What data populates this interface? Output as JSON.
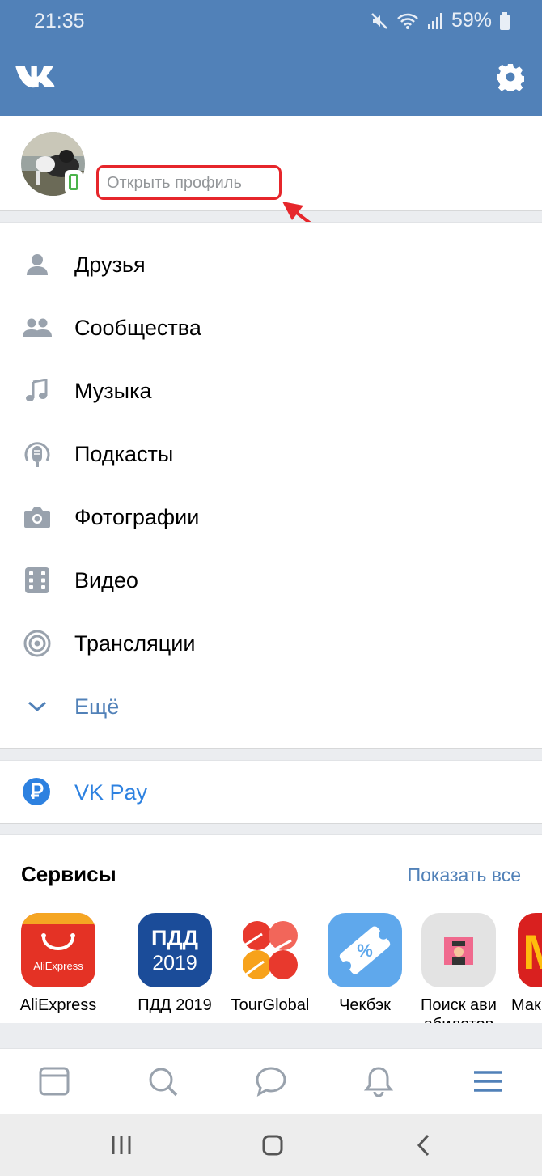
{
  "status_bar": {
    "time": "21:35",
    "battery": "59%"
  },
  "header": {
    "logo_icon": "vk-logo",
    "settings_icon": "gear-icon"
  },
  "profile": {
    "open_profile_label": "Открыть профиль",
    "avatar_icon": "avatar",
    "online_icon": "phone-icon"
  },
  "menu": {
    "items": [
      {
        "label": "Друзья",
        "icon": "person-icon"
      },
      {
        "label": "Сообщества",
        "icon": "people-icon"
      },
      {
        "label": "Музыка",
        "icon": "music-note-icon"
      },
      {
        "label": "Подкасты",
        "icon": "podcast-icon"
      },
      {
        "label": "Фотографии",
        "icon": "camera-icon"
      },
      {
        "label": "Видео",
        "icon": "video-icon"
      },
      {
        "label": "Трансляции",
        "icon": "broadcast-icon"
      },
      {
        "label": "Ещё",
        "icon": "chevron-down-icon"
      }
    ]
  },
  "vkpay": {
    "label": "VK Pay",
    "icon": "ruble-icon"
  },
  "services": {
    "title": "Сервисы",
    "show_all": "Показать все",
    "items": [
      {
        "name": "AliExpress",
        "tile_text": "AliExpress"
      },
      {
        "name": "ПДД 2019",
        "tile_text_1": "ПДД",
        "tile_text_2": "2019"
      },
      {
        "name": "TourGlobal"
      },
      {
        "name": "Чекбэк"
      },
      {
        "name": "Поиск авиабилетов",
        "name_line1": "Поиск ави",
        "name_line2": "абилетов"
      },
      {
        "name": "Мак"
      }
    ]
  },
  "tabbar": {
    "items": [
      "feed-icon",
      "search-icon",
      "messages-icon",
      "notifications-icon",
      "menu-icon"
    ]
  },
  "colors": {
    "header": "#5181b8",
    "accent": "#5181b8",
    "highlight": "#e6262b",
    "online": "#4bb34b"
  }
}
